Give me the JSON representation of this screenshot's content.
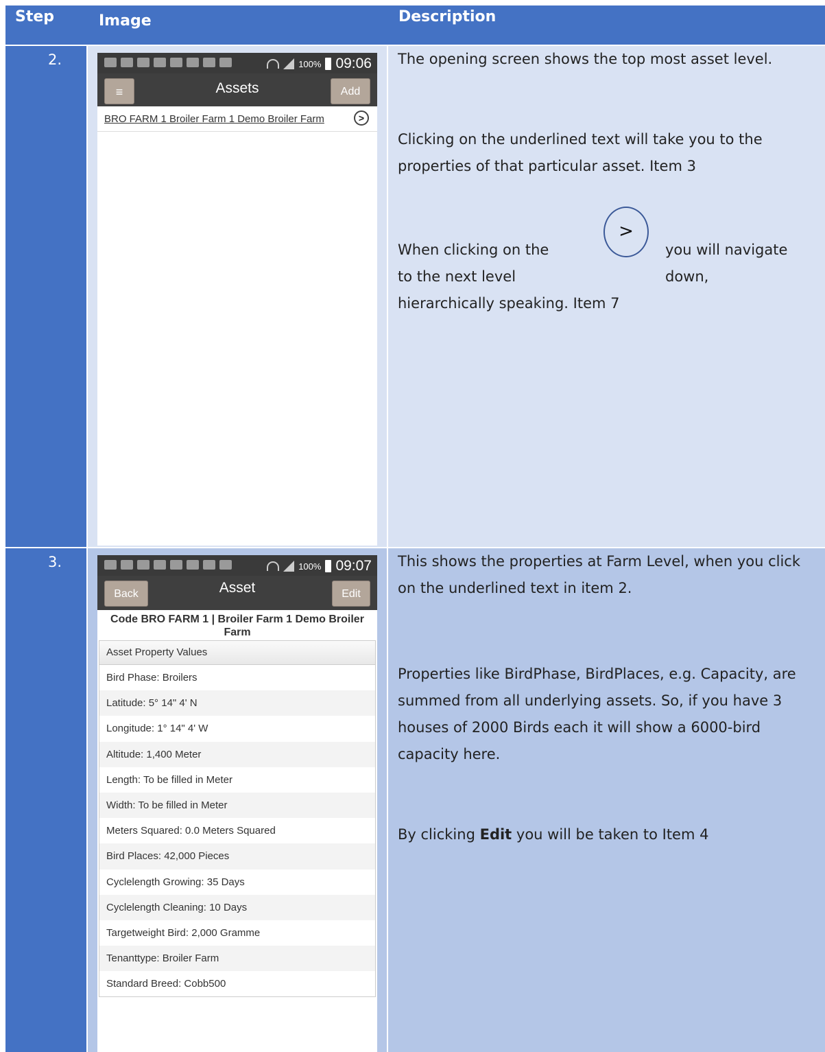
{
  "header": {
    "step": "Step",
    "image": "Image",
    "description": "Description"
  },
  "rows": [
    {
      "step": "2.",
      "phone": {
        "battery": "100%",
        "time": "09:06",
        "menu_button": "≡",
        "title": "Assets",
        "action_button": "Add",
        "list_item": "BRO FARM 1 Broiler Farm 1 Demo Broiler Farm",
        "list_chevron": ">"
      },
      "description": {
        "p1": "The opening screen shows the top most asset level.",
        "p2": "Clicking on the underlined text will take you to the properties of that particular asset. Item 3",
        "p3_before": "When clicking on the",
        "p3_after": "you will navigate",
        "p3_line2_left": "to the next level",
        "p3_line2_right": "down,",
        "p3_line3": "hierarchically speaking. Item 7",
        "circle_glyph": ">"
      },
      "colors": {
        "background": "#d9e2f3"
      }
    },
    {
      "step": "3.",
      "phone": {
        "battery": "100%",
        "time": "09:07",
        "back_button": "Back",
        "title": "Asset",
        "action_button": "Edit",
        "code_heading": "Code BRO FARM 1 | Broiler Farm 1 Demo Broiler Farm",
        "table_header": "Asset Property Values",
        "properties": [
          "Bird Phase: Broilers",
          "Latitude: 5° 14\" 4' N",
          "Longitude: 1° 14\" 4' W",
          "Altitude: 1,400 Meter",
          "Length: To be filled in Meter",
          "Width: To be filled in Meter",
          "Meters Squared: 0.0 Meters Squared",
          "Bird Places: 42,000 Pieces",
          "Cyclelength Growing: 35 Days",
          "Cyclelength Cleaning: 10 Days",
          "Targetweight Bird: 2,000 Gramme",
          "Tenanttype: Broiler Farm",
          "Standard Breed: Cobb500"
        ]
      },
      "description": {
        "p1": "This shows the properties at Farm Level, when you click on the underlined text in item 2.",
        "p2": "Properties like BirdPhase, BirdPlaces, e.g. Capacity, are summed from all underlying assets. So, if you have 3 houses of 2000 Birds each it will show a 6000-bird capacity here.",
        "p3_before": "By clicking",
        "p3_bold": "Edit",
        "p3_after": "you will be taken to Item 4"
      },
      "colors": {
        "background": "#b4c6e7"
      }
    }
  ],
  "colors": {
    "header": "#4472c4",
    "app_bar": "#3f3f3f",
    "status_bar": "#3a3a3a",
    "button": "#b3a69a"
  }
}
